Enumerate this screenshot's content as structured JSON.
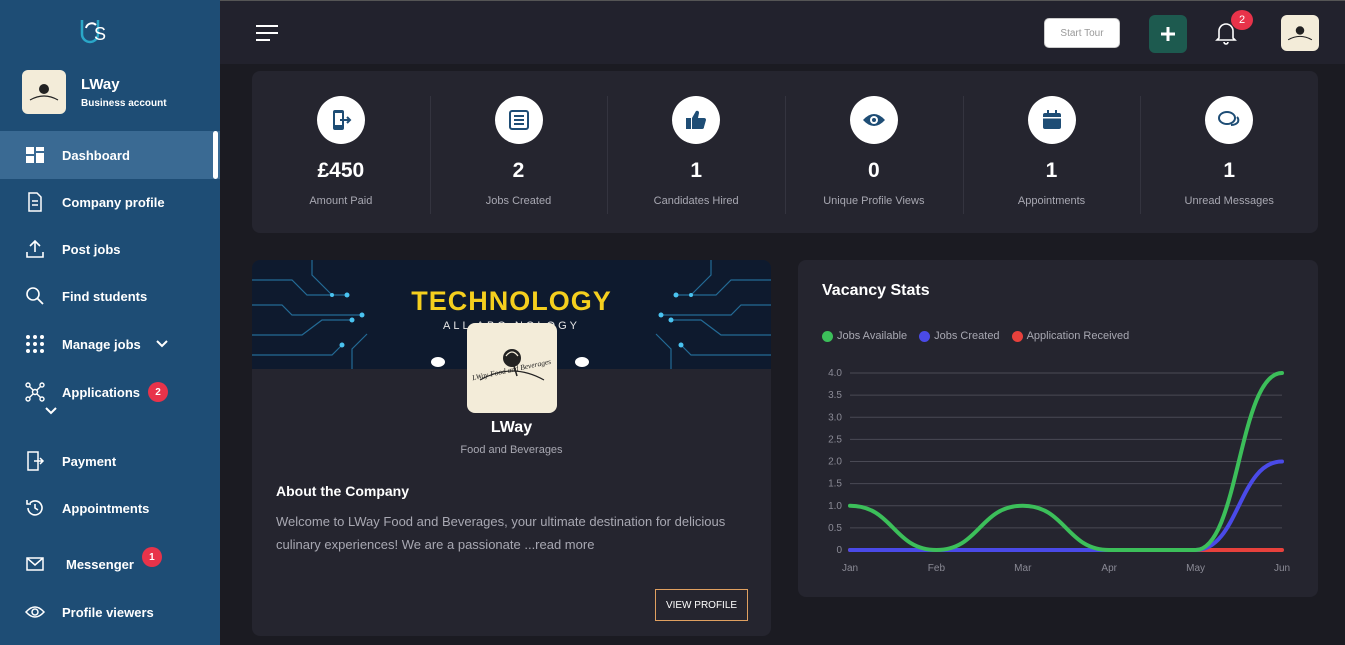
{
  "sidebar": {
    "account_name": "LWay",
    "account_type": "Business account",
    "items": [
      {
        "label": "Dashboard",
        "icon": "dashboard-icon"
      },
      {
        "label": "Company profile",
        "icon": "document-icon"
      },
      {
        "label": "Post jobs",
        "icon": "upload-icon"
      },
      {
        "label": "Find students",
        "icon": "search-icon"
      },
      {
        "label": "Manage jobs",
        "icon": "grid-icon"
      },
      {
        "label": "Applications",
        "icon": "network-icon",
        "badge": "2"
      },
      {
        "label": "Payment",
        "icon": "payment-icon"
      },
      {
        "label": "Appointments",
        "icon": "history-icon"
      },
      {
        "label": "Messenger",
        "icon": "mail-icon",
        "badge": "1"
      },
      {
        "label": "Profile viewers",
        "icon": "eye-icon"
      }
    ]
  },
  "topbar": {
    "tour_label": "Start Tour",
    "notification_count": "2"
  },
  "stats": [
    {
      "value": "£450",
      "label": "Amount Paid",
      "icon": "payment-icon"
    },
    {
      "value": "2",
      "label": "Jobs Created",
      "icon": "list-icon"
    },
    {
      "value": "1",
      "label": "Candidates Hired",
      "icon": "thumbs-up-icon"
    },
    {
      "value": "0",
      "label": "Unique Profile Views",
      "icon": "eye-icon"
    },
    {
      "value": "1",
      "label": "Appointments",
      "icon": "calendar-icon"
    },
    {
      "value": "1",
      "label": "Unread Messages",
      "icon": "chat-icon"
    }
  ],
  "profile": {
    "banner_title": "TECHNOLOGY",
    "banner_subtitle": "ALL ABO        NOLOGY",
    "logo_text": "LWay Food and Beverages",
    "name": "LWay",
    "category": "Food and Beverages",
    "about_title": "About the Company",
    "about_text": "Welcome to LWay Food and Beverages, your ultimate destination for delicious culinary experiences! We are a passionate ",
    "read_more": "...read more",
    "view_button": "VIEW PROFILE"
  },
  "chart_data": {
    "type": "line",
    "title": "Vacancy Stats",
    "categories": [
      "Jan",
      "Feb",
      "Mar",
      "Apr",
      "May",
      "Jun"
    ],
    "series": [
      {
        "name": "Jobs Available",
        "color": "#3cbf5a",
        "values": [
          1,
          0,
          1,
          0,
          0,
          4
        ]
      },
      {
        "name": "Jobs Created",
        "color": "#4a4ae8",
        "values": [
          0,
          0,
          0,
          0,
          0,
          2
        ]
      },
      {
        "name": "Application Received",
        "color": "#e8413c",
        "values": [
          0,
          0,
          0,
          0,
          0,
          0
        ]
      }
    ],
    "y_ticks": [
      "0",
      "0.5",
      "1.0",
      "1.5",
      "2.0",
      "2.5",
      "3.0",
      "3.5",
      "4.0"
    ],
    "ylim": [
      0,
      4
    ],
    "grid": true,
    "legend_position": "top-left"
  }
}
